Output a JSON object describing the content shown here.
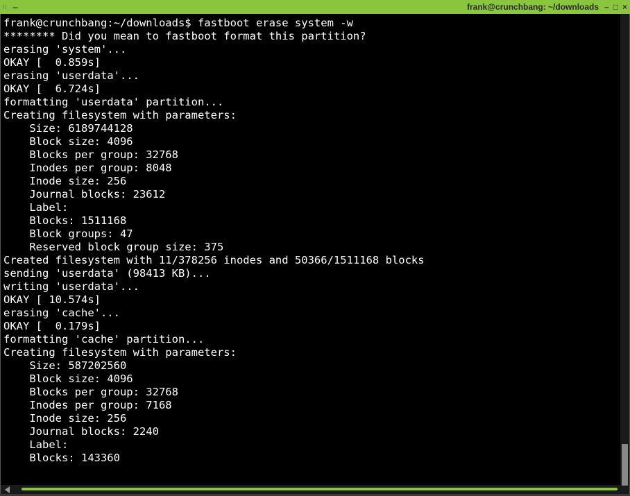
{
  "titlebar": {
    "title": "frank@crunchbang: ~/downloads"
  },
  "terminal": {
    "prompt": "frank@crunchbang:~/downloads$ ",
    "command": "fastboot erase system -w",
    "lines": [
      "******** Did you mean to fastboot format this partition?",
      "erasing 'system'...",
      "OKAY [  0.859s]",
      "erasing 'userdata'...",
      "OKAY [  6.724s]",
      "formatting 'userdata' partition...",
      "Creating filesystem with parameters:",
      "    Size: 6189744128",
      "    Block size: 4096",
      "    Blocks per group: 32768",
      "    Inodes per group: 8048",
      "    Inode size: 256",
      "    Journal blocks: 23612",
      "    Label:",
      "    Blocks: 1511168",
      "    Block groups: 47",
      "    Reserved block group size: 375",
      "Created filesystem with 11/378256 inodes and 50366/1511168 blocks",
      "sending 'userdata' (98413 KB)...",
      "writing 'userdata'...",
      "OKAY [ 10.574s]",
      "erasing 'cache'...",
      "OKAY [  0.179s]",
      "formatting 'cache' partition...",
      "Creating filesystem with parameters:",
      "    Size: 587202560",
      "    Block size: 4096",
      "    Blocks per group: 32768",
      "    Inodes per group: 7168",
      "    Inode size: 256",
      "    Journal blocks: 2240",
      "    Label:",
      "    Blocks: 143360"
    ]
  }
}
